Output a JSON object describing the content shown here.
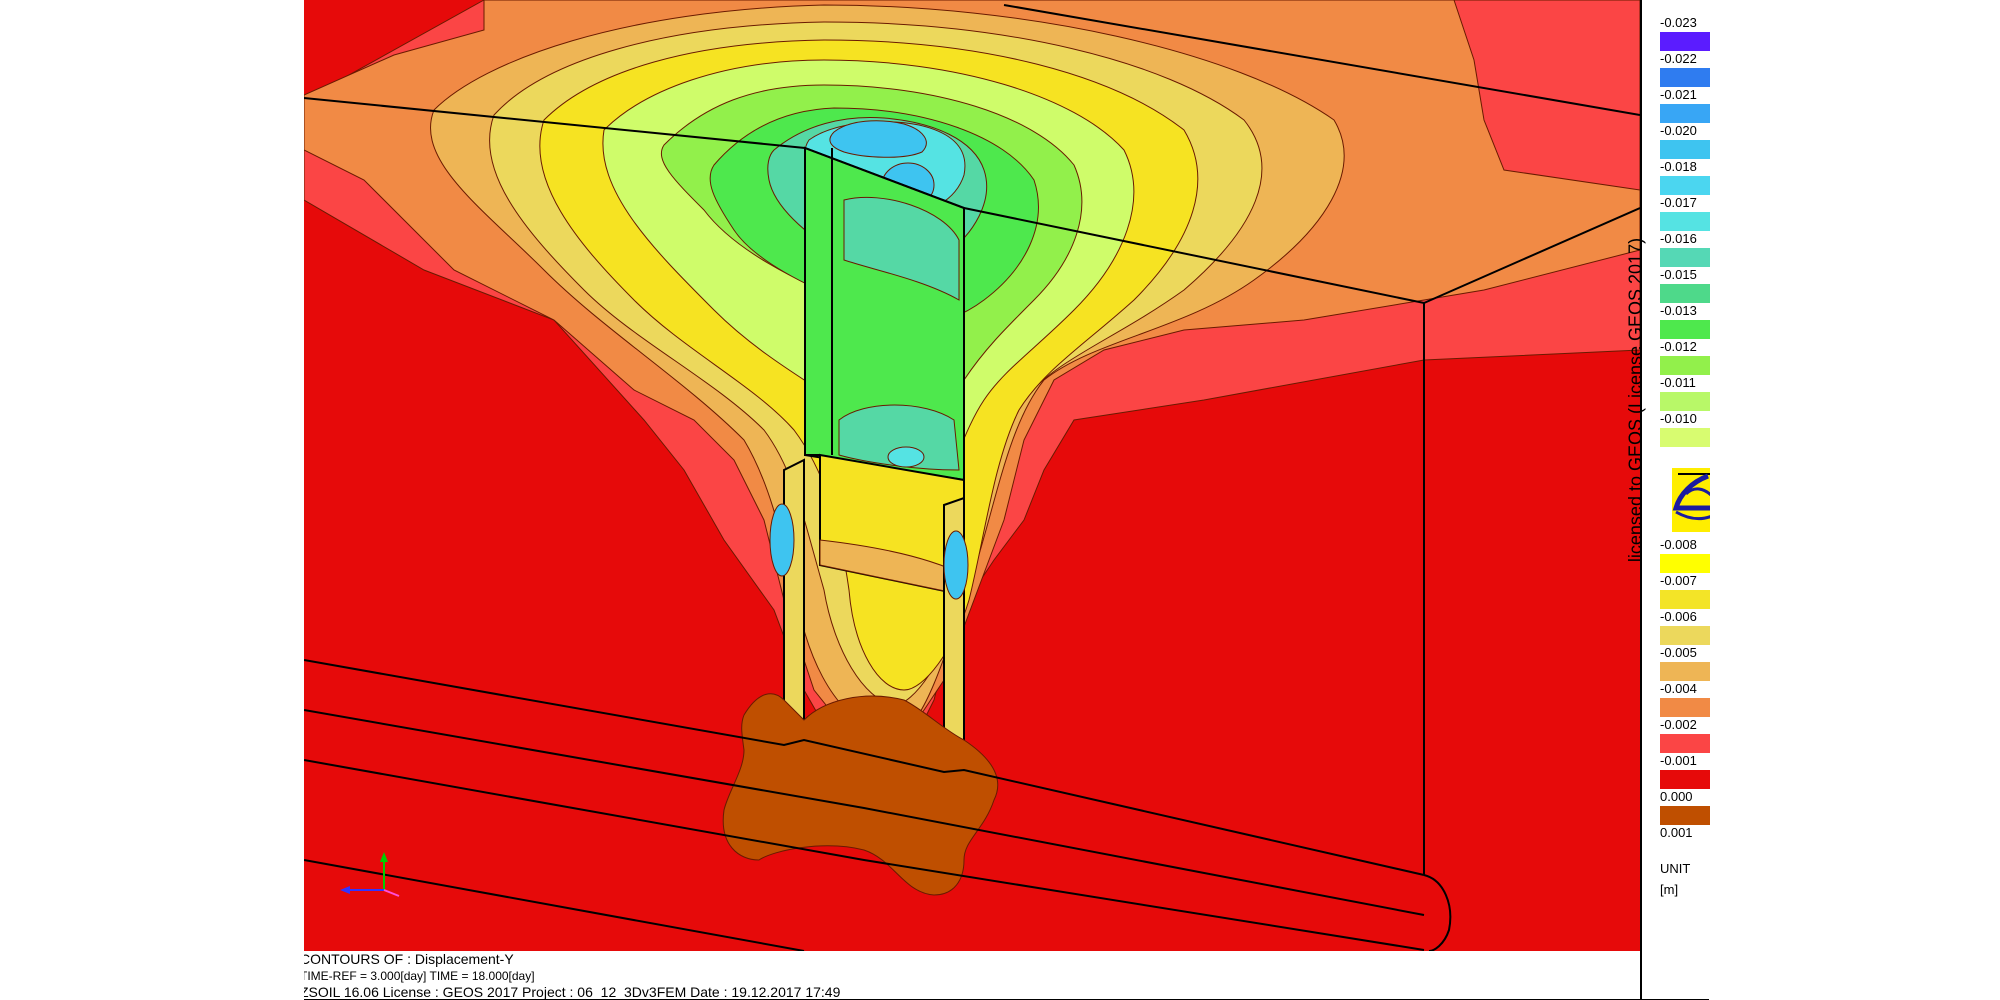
{
  "window": {
    "title": "Displacement-Y contour plot"
  },
  "plot": {
    "result_name": "Displacement-Y",
    "colors": {
      "background_far": "#e60a0a",
      "band_light_red": "#fb4545",
      "band_orange": "#f18a45",
      "band_light_orange": "#eeb555",
      "band_pale_yellow": "#ecd85c",
      "band_yellow": "#f6e322",
      "band_lime": "#cffc6a",
      "band_light_green": "#92f04b",
      "band_green": "#4ee84d",
      "band_teal": "#55d8a5",
      "band_cyan": "#55e3e3",
      "band_blue": "#3ec4f0",
      "band_brown": "#bf4f00",
      "axis_y": "#00d000",
      "axis_x": "#3333ff"
    }
  },
  "legend": {
    "items": [
      {
        "label": "-0.023",
        "color": "#5b1cff"
      },
      {
        "label": "-0.022",
        "color": "#2f7cf0"
      },
      {
        "label": "-0.021",
        "color": "#38a6f5"
      },
      {
        "label": "-0.020",
        "color": "#3ec4f0"
      },
      {
        "label": "-0.018",
        "color": "#4bd6f0"
      },
      {
        "label": "-0.017",
        "color": "#55e3e3"
      },
      {
        "label": "-0.016",
        "color": "#55d8b5"
      },
      {
        "label": "-0.015",
        "color": "#4ed98a"
      },
      {
        "label": "-0.013",
        "color": "#4ee84d"
      },
      {
        "label": "-0.012",
        "color": "#92f04b"
      },
      {
        "label": "-0.011",
        "color": "#b8f868"
      },
      {
        "label": "-0.010",
        "color": "#d8fc70"
      },
      {
        "label": "-0.008",
        "color": "#ffff00"
      },
      {
        "label": "-0.007",
        "color": "#f3e427"
      },
      {
        "label": "-0.006",
        "color": "#ecd85c"
      },
      {
        "label": "-0.005",
        "color": "#eeb555"
      },
      {
        "label": "-0.004",
        "color": "#f18a45"
      },
      {
        "label": "-0.002",
        "color": "#fb4545"
      },
      {
        "label": "-0.001",
        "color": "#e60a0a"
      },
      {
        "label": "0.000",
        "color": "#bf4f00"
      },
      {
        "label": "0.001",
        "color": ""
      }
    ],
    "unit_title": "UNIT",
    "unit_value": "[m]",
    "logo_icon": "zsoil-logo-icon"
  },
  "license_text": "licensed to GEOS (License  GEOS 2017)",
  "info": {
    "contours_line": "CONTOURS OF : Displacement-Y",
    "time_line": "TIME-REF = 3.000[day]   TIME = 18.000[day]",
    "software_line": "ZSOIL 16.06   License :  GEOS 2017   Project : 06_12_3Dv3FEM     Date : 19.12.2017  17:49"
  }
}
